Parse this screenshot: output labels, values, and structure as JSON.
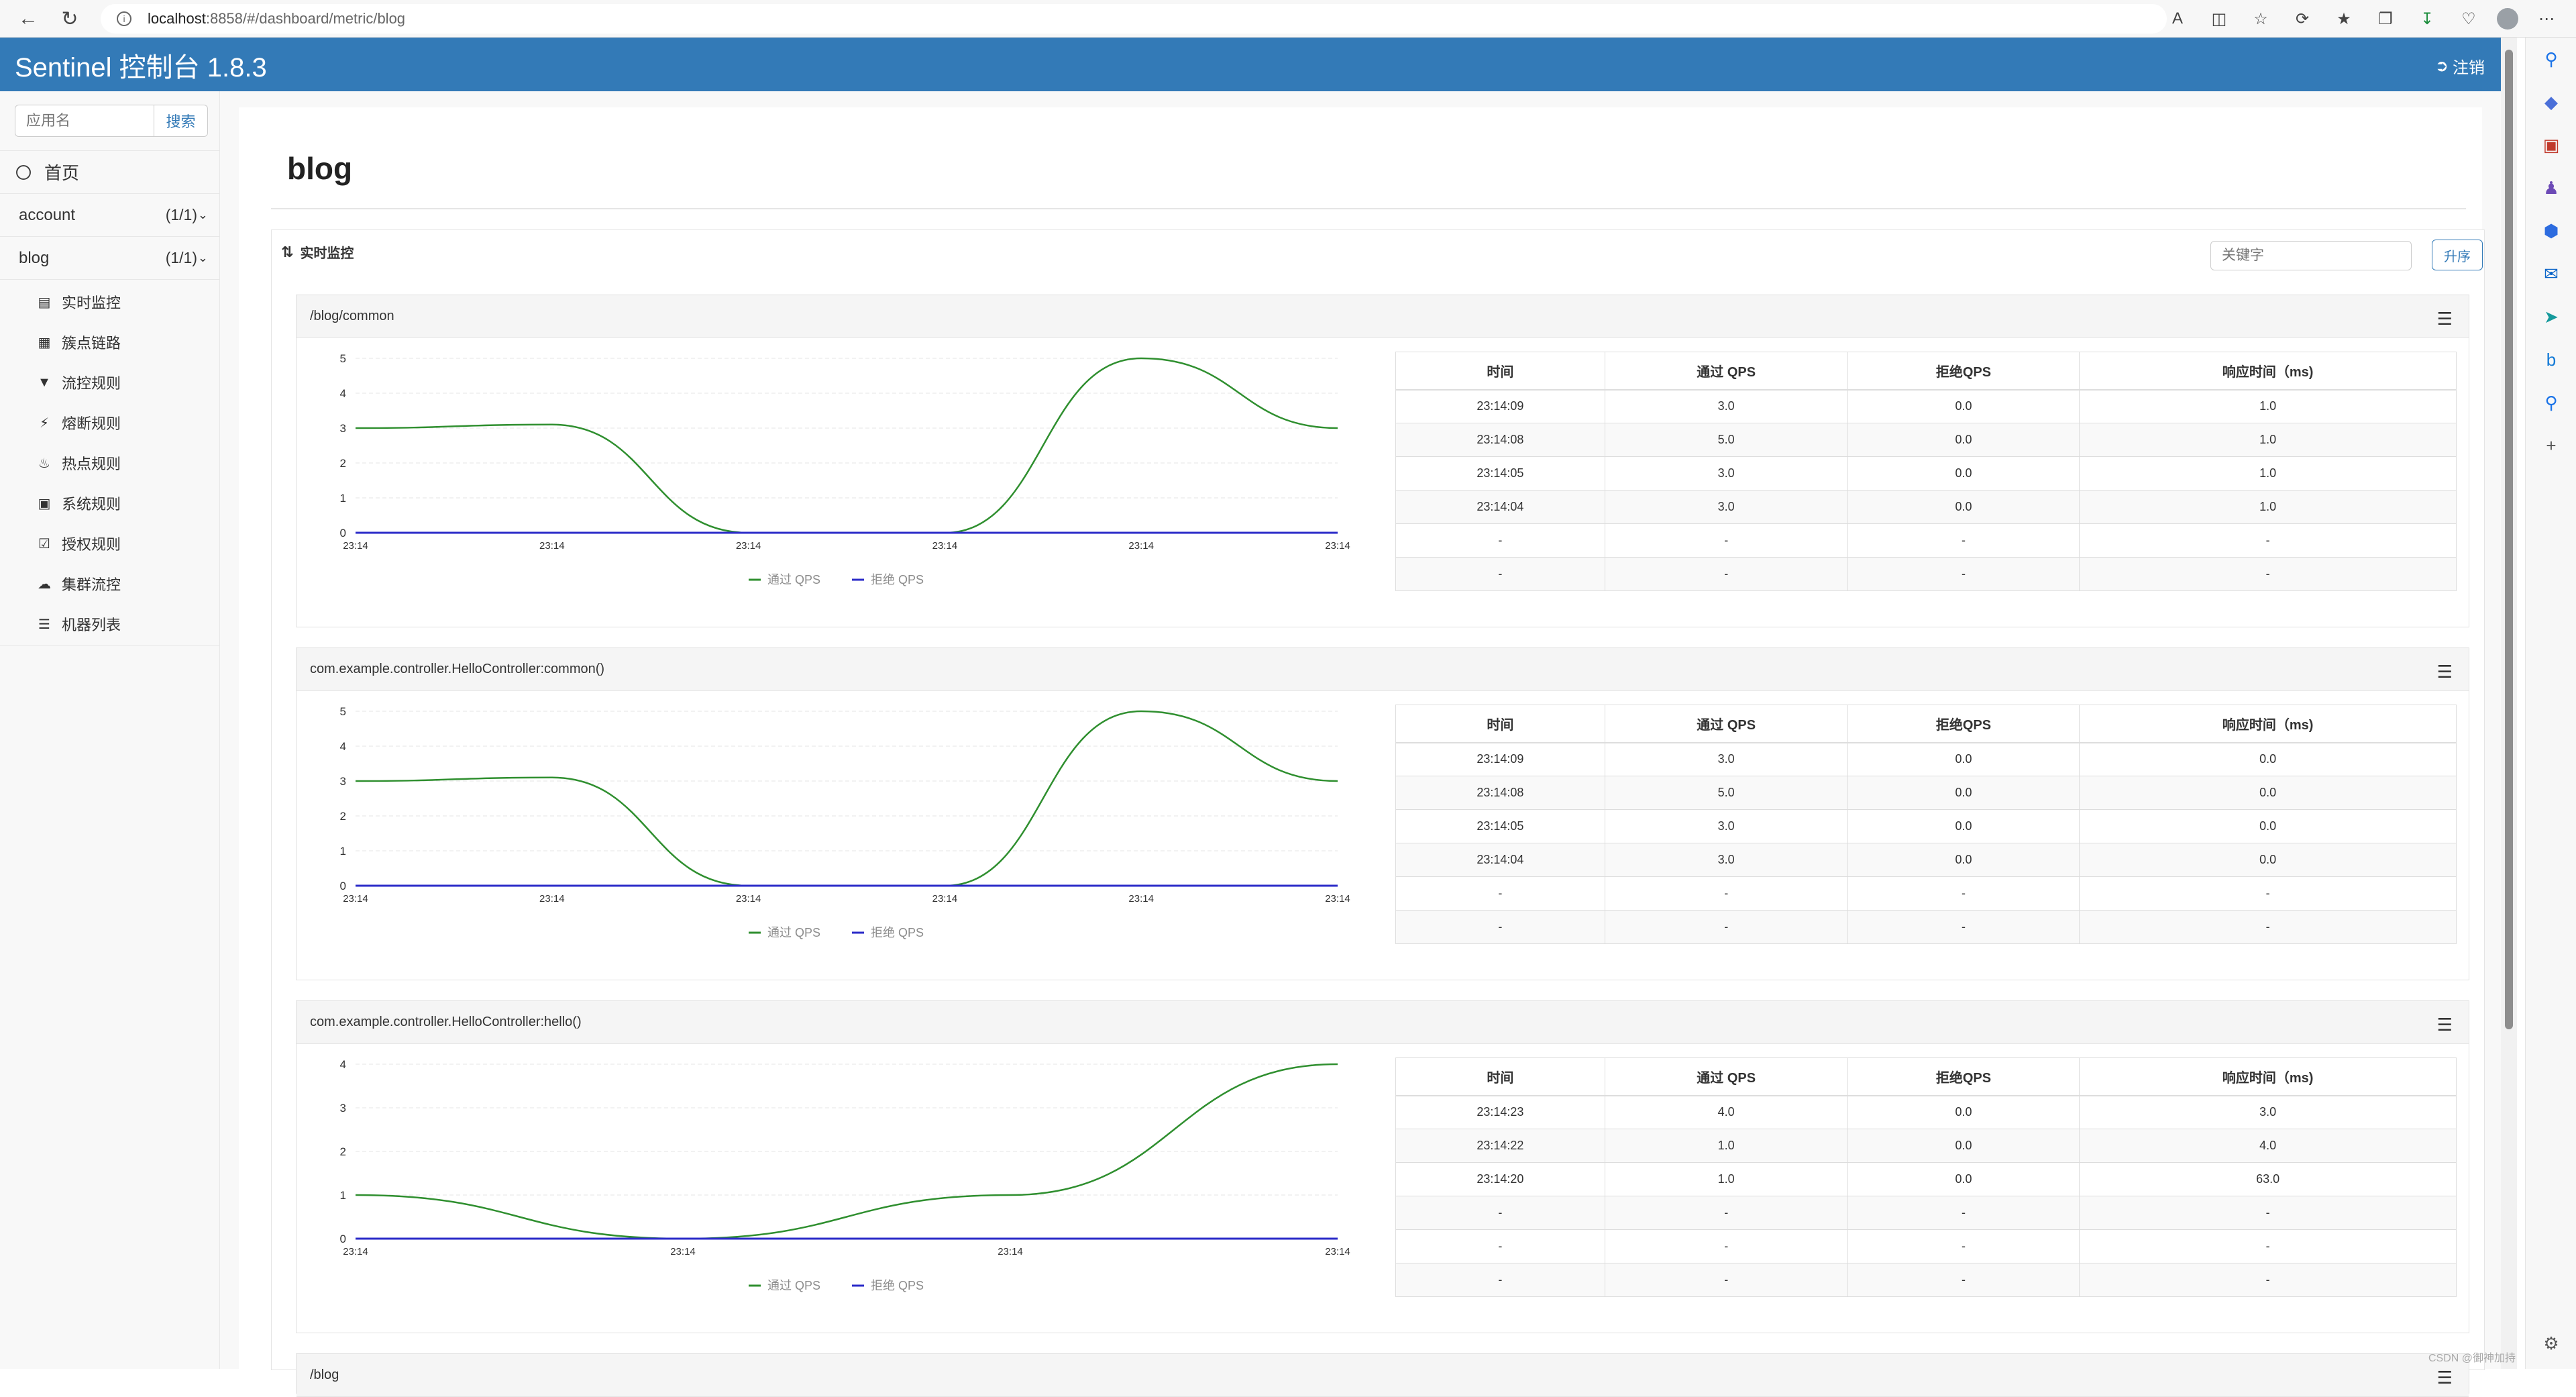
{
  "browser": {
    "url_host": "localhost",
    "url_path": ":8858/#/dashboard/metric/blog"
  },
  "app": {
    "title": "Sentinel 控制台 1.8.3",
    "logout_label": "注销"
  },
  "sidebar": {
    "search_placeholder": "应用名",
    "search_button": "搜索",
    "home_label": "首页",
    "apps": [
      {
        "name": "account",
        "count": "(1/1)"
      },
      {
        "name": "blog",
        "count": "(1/1)"
      }
    ],
    "sub_items": [
      {
        "label": "实时监控",
        "icon": "bar-chart-icon"
      },
      {
        "label": "簇点链路",
        "icon": "list-icon"
      },
      {
        "label": "流控规则",
        "icon": "filter-icon"
      },
      {
        "label": "熔断规则",
        "icon": "flash-icon"
      },
      {
        "label": "热点规则",
        "icon": "fire-icon"
      },
      {
        "label": "系统规则",
        "icon": "lock-icon"
      },
      {
        "label": "授权规则",
        "icon": "check-icon"
      },
      {
        "label": "集群流控",
        "icon": "cloud-icon"
      },
      {
        "label": "机器列表",
        "icon": "th-list-icon"
      }
    ]
  },
  "main": {
    "page_title": "blog",
    "monitor_label": "实时监控",
    "keyword_placeholder": "关键字",
    "sort_button": "升序",
    "table_headers": [
      "时间",
      "通过 QPS",
      "拒绝QPS",
      "响应时间（ms)"
    ],
    "legend_pass": "通过 QPS",
    "legend_block": "拒绝 QPS",
    "colors": {
      "pass": "#2f8f2f",
      "block": "#2b2bc8",
      "header_blue": "#337ab7"
    },
    "resources": [
      {
        "name": "/blog/common",
        "rows": [
          [
            "23:14:09",
            "3.0",
            "0.0",
            "1.0"
          ],
          [
            "23:14:08",
            "5.0",
            "0.0",
            "1.0"
          ],
          [
            "23:14:05",
            "3.0",
            "0.0",
            "1.0"
          ],
          [
            "23:14:04",
            "3.0",
            "0.0",
            "1.0"
          ],
          [
            "-",
            "-",
            "-",
            "-"
          ],
          [
            "-",
            "-",
            "-",
            "-"
          ]
        ]
      },
      {
        "name": "com.example.controller.HelloController:common()",
        "rows": [
          [
            "23:14:09",
            "3.0",
            "0.0",
            "0.0"
          ],
          [
            "23:14:08",
            "5.0",
            "0.0",
            "0.0"
          ],
          [
            "23:14:05",
            "3.0",
            "0.0",
            "0.0"
          ],
          [
            "23:14:04",
            "3.0",
            "0.0",
            "0.0"
          ],
          [
            "-",
            "-",
            "-",
            "-"
          ],
          [
            "-",
            "-",
            "-",
            "-"
          ]
        ]
      },
      {
        "name": "com.example.controller.HelloController:hello()",
        "rows": [
          [
            "23:14:23",
            "4.0",
            "0.0",
            "3.0"
          ],
          [
            "23:14:22",
            "1.0",
            "0.0",
            "4.0"
          ],
          [
            "23:14:20",
            "1.0",
            "0.0",
            "63.0"
          ],
          [
            "-",
            "-",
            "-",
            "-"
          ],
          [
            "-",
            "-",
            "-",
            "-"
          ],
          [
            "-",
            "-",
            "-",
            "-"
          ]
        ]
      },
      {
        "name": "/blog",
        "rows": []
      }
    ]
  },
  "watermark": "CSDN @御神加持",
  "chart_data": [
    {
      "type": "line",
      "x": [
        "23:14",
        "23:14",
        "23:14",
        "23:14",
        "23:14",
        "23:14"
      ],
      "ylim": [
        0,
        5
      ],
      "yticks": [
        "0",
        "1",
        "2",
        "3",
        "4",
        "5"
      ],
      "series": [
        {
          "name": "通过 QPS",
          "values": [
            3,
            3.1,
            0,
            0,
            5,
            3
          ]
        },
        {
          "name": "拒绝 QPS",
          "values": [
            0,
            0,
            0,
            0,
            0,
            0
          ]
        }
      ],
      "grid": true,
      "legend": "bottom"
    },
    {
      "type": "line",
      "x": [
        "23:14",
        "23:14",
        "23:14",
        "23:14",
        "23:14",
        "23:14"
      ],
      "ylim": [
        0,
        5
      ],
      "yticks": [
        "0",
        "1",
        "2",
        "3",
        "4",
        "5"
      ],
      "series": [
        {
          "name": "通过 QPS",
          "values": [
            3,
            3.1,
            0,
            0,
            5,
            3
          ]
        },
        {
          "name": "拒绝 QPS",
          "values": [
            0,
            0,
            0,
            0,
            0,
            0
          ]
        }
      ],
      "grid": true,
      "legend": "bottom"
    },
    {
      "type": "line",
      "x": [
        "23:14",
        "23:14",
        "23:14",
        "23:14"
      ],
      "ylim": [
        0,
        4
      ],
      "yticks": [
        "0",
        "1",
        "2",
        "3",
        "4"
      ],
      "series": [
        {
          "name": "通过 QPS",
          "values": [
            1,
            0,
            1,
            4
          ]
        },
        {
          "name": "拒绝 QPS",
          "values": [
            0,
            0,
            0,
            0
          ]
        }
      ],
      "grid": true,
      "legend": "bottom"
    }
  ]
}
